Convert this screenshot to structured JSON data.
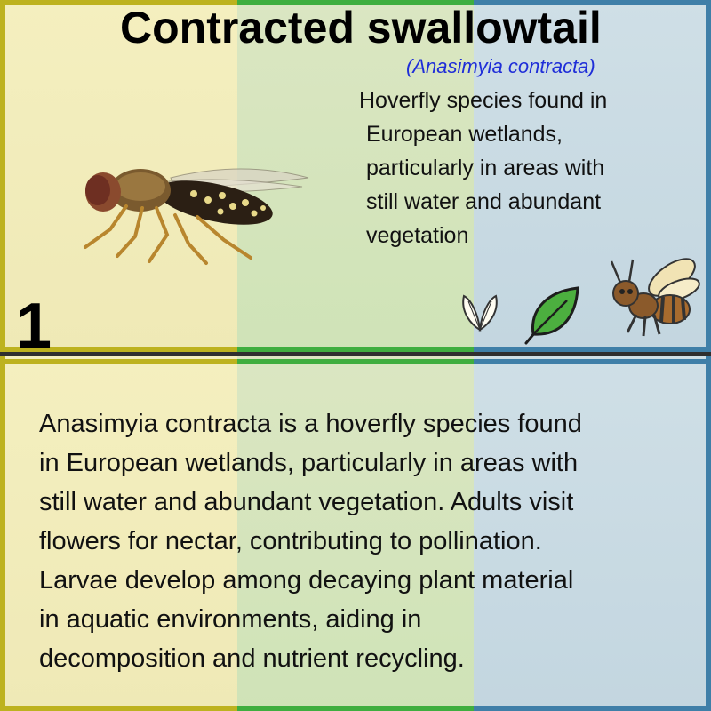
{
  "card": {
    "title": "Contracted swallowtail",
    "scientific_name": "(Anasimyia contracta)",
    "short_description_lines": [
      "Hoverfly species found in",
      "European wetlands,",
      "particularly in areas with",
      "still water and abundant",
      "vegetation"
    ],
    "number": "1",
    "long_description_lines": [
      "Anasimyia contracta is a hoverfly species found",
      "in European wetlands, particularly in areas with",
      "still water and abundant vegetation. Adults visit",
      "flowers for nectar, contributing to pollination.",
      "Larvae develop among decaying plant material",
      "in aquatic environments, aiding in",
      "decomposition and nutrient recycling."
    ],
    "icons": [
      "wings-icon",
      "leaf-icon",
      "bee-icon"
    ]
  },
  "colors": {
    "yellow_band": "#bdb21f",
    "green_band": "#3fae3f",
    "blue_band": "#3f7fa8",
    "scientific_name": "#1f2ed8"
  }
}
